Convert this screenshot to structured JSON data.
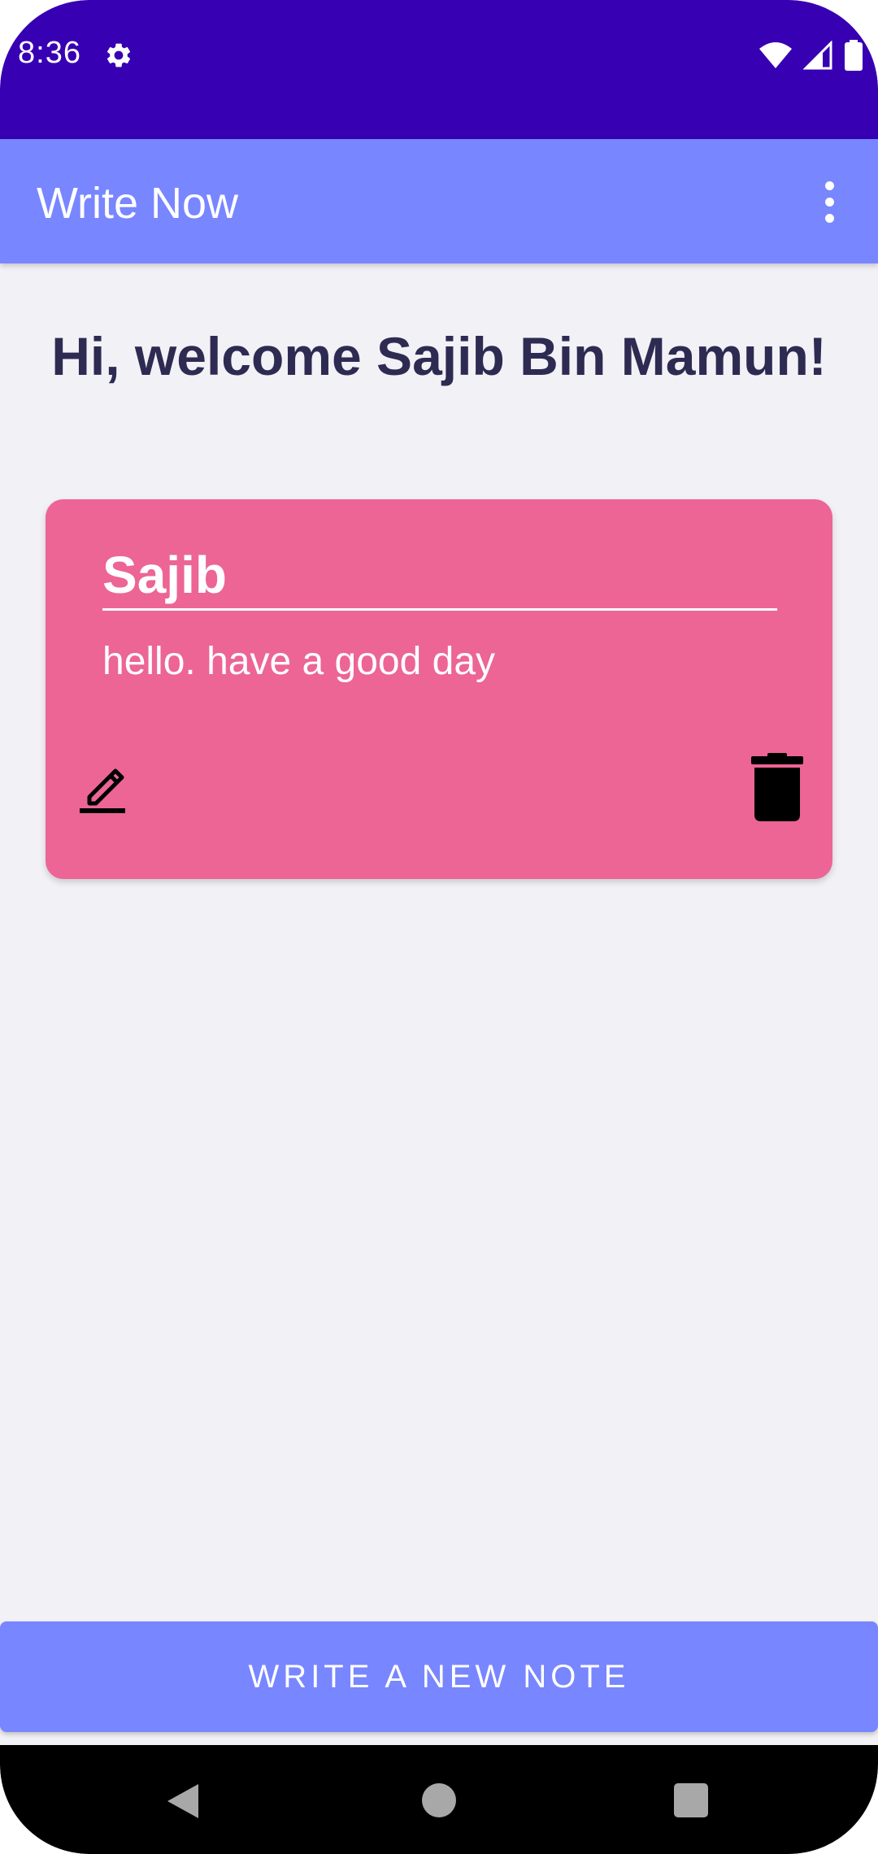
{
  "status_bar": {
    "time": "8:36",
    "icons": [
      "settings-gear-icon",
      "wifi-icon",
      "cellular-signal-icon",
      "battery-icon"
    ]
  },
  "app_bar": {
    "title": "Write Now",
    "overflow_icon": "more-vert-icon"
  },
  "welcome_text": "Hi, welcome Sajib Bin Mamun!",
  "notes": [
    {
      "title": "Sajib",
      "body": "hello. have a good day",
      "edit_icon": "edit-pencil-icon",
      "delete_icon": "trash-icon",
      "color": "#ec6594"
    }
  ],
  "new_note_button": "WRITE A NEW NOTE",
  "colors": {
    "status_bar": "#3700b3",
    "primary": "#7886ff",
    "background": "#f2f1f6",
    "welcome_text": "#2e2b52"
  },
  "nav_bar": {
    "icons": [
      "back-icon",
      "home-icon",
      "recents-icon"
    ]
  }
}
